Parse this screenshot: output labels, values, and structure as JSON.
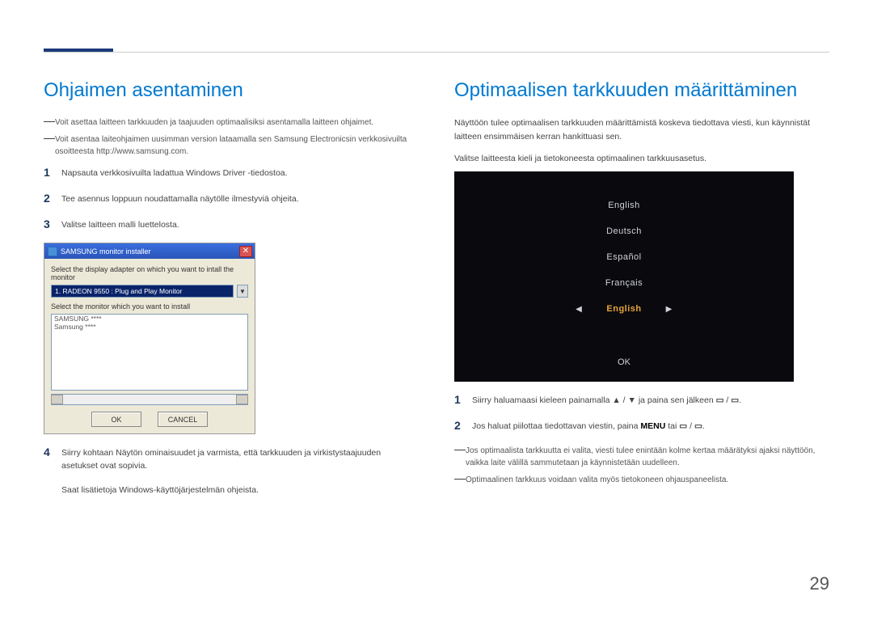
{
  "page_number": "29",
  "left": {
    "title": "Ohjaimen asentaminen",
    "note1": "Voit asettaa laitteen tarkkuuden ja taajuuden optimaalisiksi asentamalla laitteen ohjaimet.",
    "note2": "Voit asentaa laiteohjaimen uusimman version lataamalla sen Samsung Electronicsin verkkosivuilta osoitteesta http://www.samsung.com.",
    "step1": "Napsauta verkkosivuilta ladattua Windows Driver -tiedostoa.",
    "step2": "Tee asennus loppuun noudattamalla näytölle ilmestyviä ohjeita.",
    "step3": "Valitse laitteen malli luettelosta.",
    "step4": "Siirry kohtaan Näytön ominaisuudet ja varmista, että tarkkuuden ja virkistystaajuuden asetukset ovat sopivia.",
    "step4b": "Saat lisätietoja Windows-käyttöjärjestelmän ohjeista.",
    "installer": {
      "window_title": "SAMSUNG monitor installer",
      "label1": "Select the display adapter on which you want to intall the monitor",
      "adapter": "1. RADEON 9550 : Plug and Play Monitor",
      "label2": "Select the monitor which you want to install",
      "list_item1": "SAMSUNG ****",
      "list_item2": "Samsung ****",
      "ok": "OK",
      "cancel": "CANCEL"
    }
  },
  "right": {
    "title": "Optimaalisen tarkkuuden määrittäminen",
    "intro1": "Näyttöön tulee optimaalisen tarkkuuden määrittämistä koskeva tiedottava viesti, kun käynnistät laitteen ensimmäisen kerran hankittuasi sen.",
    "intro2": "Valitse laitteesta kieli ja tietokoneesta optimaalinen tarkkuusasetus.",
    "osd": {
      "top_item": "English",
      "item2": "Deutsch",
      "item3": "Español",
      "item4": "Français",
      "selected": "English",
      "ok": "OK"
    },
    "step1_a": "Siirry haluamaasi kieleen painamalla ",
    "step1_b": " ja paina sen jälkeen ",
    "step1_c": ".",
    "step2_a": "Jos haluat piilottaa tiedottavan viestin, paina ",
    "step2_menu": "MENU",
    "step2_b": " tai ",
    "step2_c": ".",
    "note1": "Jos optimaalista tarkkuutta ei valita, viesti tulee enintään kolme kertaa määrätyksi ajaksi näyttöön, vaikka laite välillä sammutetaan ja käynnistetään uudelleen.",
    "note2_a": "Optimaalinen tarkkuus voidaan valita myös tietokoneen ",
    "note2_bold": "ohjauspaneelista",
    "note2_b": "."
  }
}
